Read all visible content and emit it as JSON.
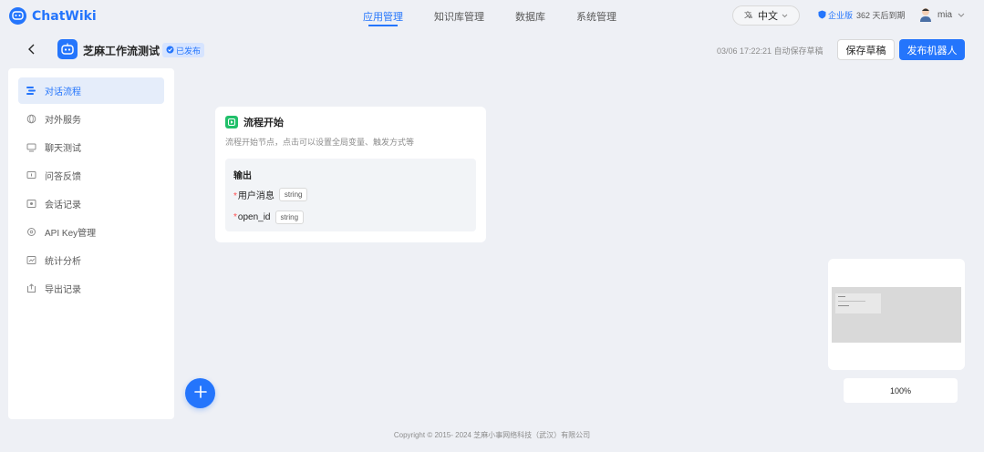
{
  "topbar": {
    "brand": "ChatWiki",
    "nav": [
      {
        "label": "应用管理",
        "active": true
      },
      {
        "label": "知识库管理",
        "active": false
      },
      {
        "label": "数据库",
        "active": false
      },
      {
        "label": "系统管理",
        "active": false
      }
    ],
    "language": "中文",
    "edition_label": "企业版",
    "edition_days": "362 天后到期",
    "username": "mia"
  },
  "header": {
    "app_title": "芝麻工作流测试",
    "status_badge": "已发布",
    "autosave_text": "03/06 17:22:21 自动保存草稿",
    "save_draft_label": "保存草稿",
    "publish_label": "发布机器人"
  },
  "sidebar": {
    "items": [
      {
        "label": "对话流程",
        "icon": "flow-icon",
        "active": true
      },
      {
        "label": "对外服务",
        "icon": "globe-icon",
        "active": false
      },
      {
        "label": "聊天测试",
        "icon": "chat-test-icon",
        "active": false
      },
      {
        "label": "问答反馈",
        "icon": "feedback-icon",
        "active": false
      },
      {
        "label": "会话记录",
        "icon": "session-record-icon",
        "active": false
      },
      {
        "label": "API Key管理",
        "icon": "key-icon",
        "active": false
      },
      {
        "label": "统计分析",
        "icon": "stats-icon",
        "active": false
      },
      {
        "label": "导出记录",
        "icon": "export-icon",
        "active": false
      }
    ]
  },
  "node": {
    "title": "流程开始",
    "description": "流程开始节点，点击可以设置全局变量、触发方式等",
    "output_label": "输出",
    "outputs": [
      {
        "name": "用户消息",
        "type": "string",
        "required": true
      },
      {
        "name": "open_id",
        "type": "string",
        "required": true
      }
    ]
  },
  "zoom_level": "100%",
  "footer": "Copyright © 2015- 2024 芝麻小事网络科技（武汉）有限公司",
  "colors": {
    "accent": "#2475fc",
    "node_icon": "#21c06a",
    "background": "#eef0f5"
  }
}
